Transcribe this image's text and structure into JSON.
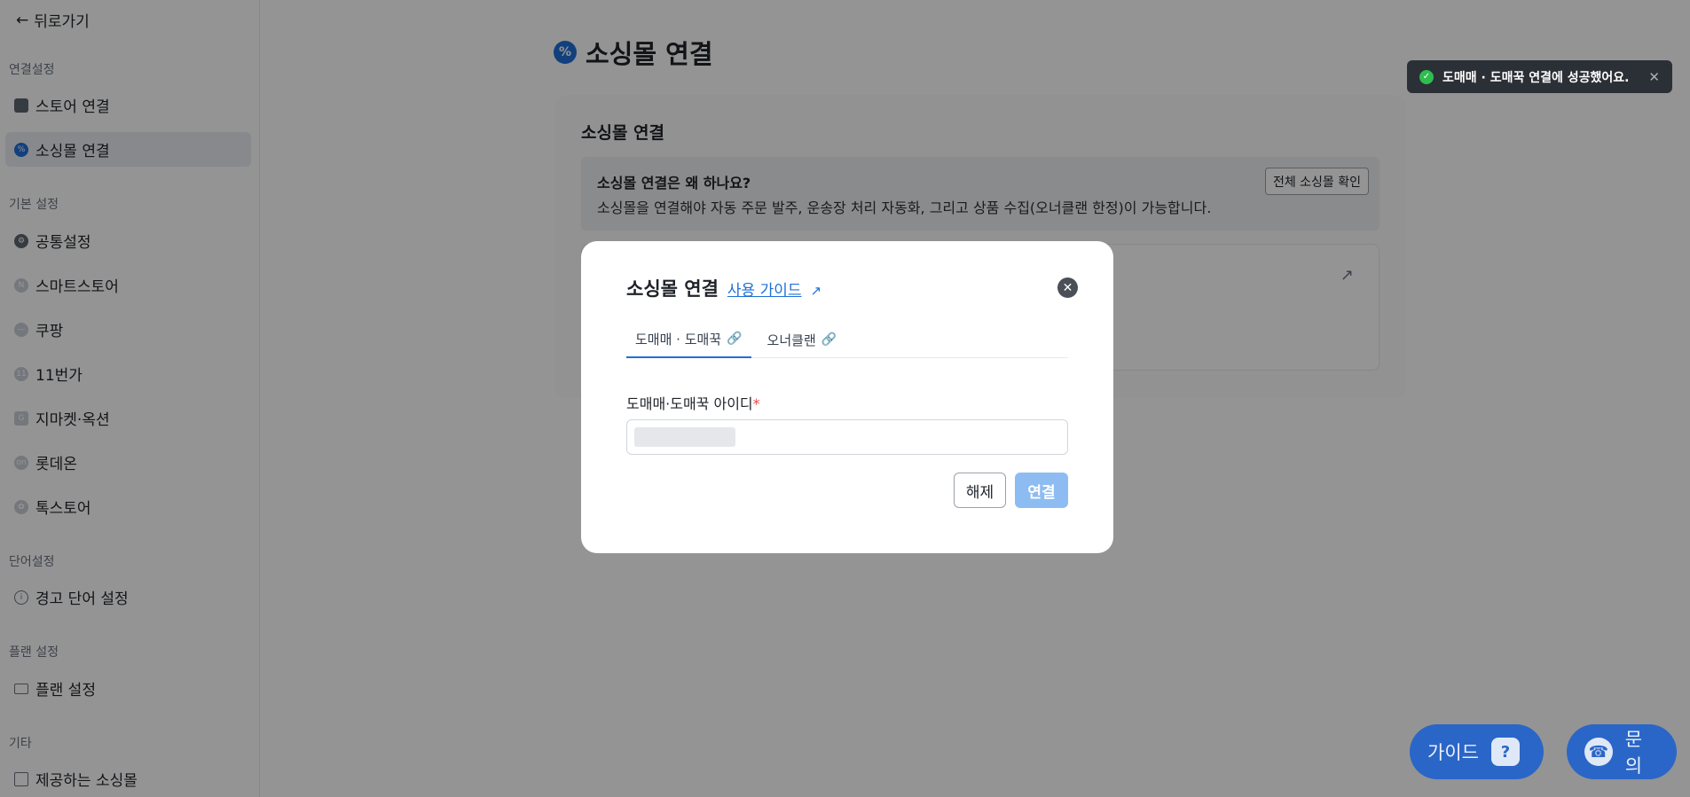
{
  "sidebar": {
    "back_label": "뒤로가기",
    "sections": [
      {
        "title": "연결설정",
        "items": [
          {
            "label": "스토어 연결",
            "icon": "store-icon"
          },
          {
            "label": "소싱몰 연결",
            "icon": "sourcing-badge-icon",
            "active": true
          }
        ]
      },
      {
        "title": "기본 설정",
        "items": [
          {
            "label": "공통설정",
            "icon": "gear-icon"
          },
          {
            "label": "스마트스토어",
            "icon": "smartstore-logo-icon"
          },
          {
            "label": "쿠팡",
            "icon": "coupang-logo-icon"
          },
          {
            "label": "11번가",
            "icon": "11st-logo-icon"
          },
          {
            "label": "지마켓·옥션",
            "icon": "gmarket-auction-logo-icon"
          },
          {
            "label": "롯데온",
            "icon": "lotteon-logo-icon"
          },
          {
            "label": "톡스토어",
            "icon": "talkstore-logo-icon"
          }
        ]
      },
      {
        "title": "단어설정",
        "items": [
          {
            "label": "경고 단어 설정",
            "icon": "info-circle-icon"
          }
        ]
      },
      {
        "title": "플랜 설정",
        "items": [
          {
            "label": "플랜 설정",
            "icon": "card-icon"
          }
        ]
      },
      {
        "title": "기타",
        "items": [
          {
            "label": "제공하는 소싱몰",
            "icon": "building-icon"
          }
        ]
      }
    ]
  },
  "main": {
    "page_title": "소싱몰 연결",
    "card_title": "소싱몰 연결",
    "info_question": "소싱몰 연결은 왜 하나요?",
    "info_answer": "소싱몰을 연결해야 자동 주문 발주, 운송장 처리 자동화, 그리고 상품 수집(오너클랜 한정)이 가능합니다.",
    "all_button": "전체 소싱몰 확인"
  },
  "toast": {
    "message": "도매매 · 도매꾹 연결에 성공했어요."
  },
  "modal": {
    "title": "소싱몰 연결",
    "guide_link": "사용 가이드",
    "tabs": [
      {
        "label": "도매매 · 도매꾹",
        "active": true
      },
      {
        "label": "오너클랜",
        "active": false
      }
    ],
    "field_label": "도매매·도매꾹 아이디",
    "required_mark": "*",
    "release_button": "해제",
    "connect_button": "연결"
  },
  "floating": {
    "guide_label": "가이드",
    "inquiry_label": "문의"
  },
  "colors": {
    "accent": "#1f6fd8",
    "fab": "#2a66c7",
    "connect_disabled": "#8dbcf2",
    "toast_bg": "#2b2f36",
    "toast_success": "#2ebd4f"
  }
}
